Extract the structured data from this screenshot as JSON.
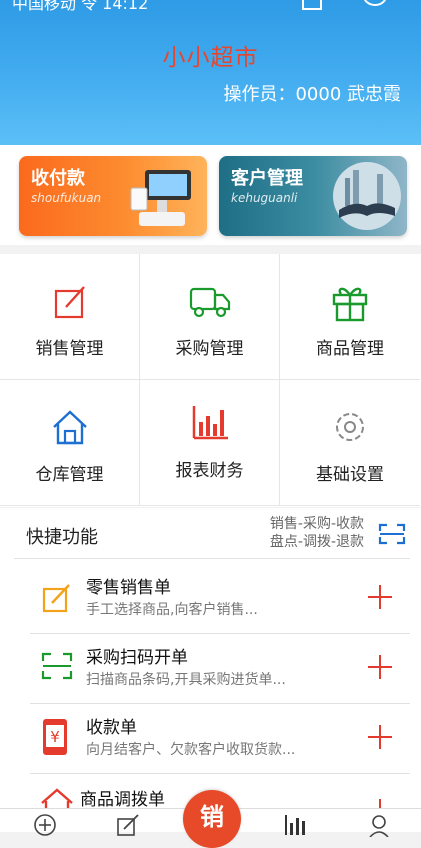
{
  "header": {
    "status_text": "中国移动 令 14:12",
    "store_name": "小小超市",
    "operator": "操作员：0000 武忠霞"
  },
  "banners": [
    {
      "title": "收付款",
      "subtitle": "shoufukuan"
    },
    {
      "title": "客户管理",
      "subtitle": "kehuguanli"
    }
  ],
  "grid": [
    {
      "label": "销售管理",
      "icon": "edit-icon",
      "color": "#e53a2e"
    },
    {
      "label": "采购管理",
      "icon": "truck-icon",
      "color": "#1a9a2c"
    },
    {
      "label": "商品管理",
      "icon": "gift-icon",
      "color": "#1a9a2c"
    },
    {
      "label": "仓库管理",
      "icon": "house-icon",
      "color": "#1d6fd1"
    },
    {
      "label": "报表财务",
      "icon": "bar-chart-icon",
      "color": "#e53a2e"
    },
    {
      "label": "基础设置",
      "icon": "gear-icon",
      "color": "#888888"
    }
  ],
  "quick": {
    "title": "快捷功能",
    "subtitle_line1": "销售-采购-收款",
    "subtitle_line2": "盘点-调拨-退款",
    "items": [
      {
        "title": "零售销售单",
        "desc": "手工选择商品,向客户销售...",
        "icon": "edit-icon"
      },
      {
        "title": "采购扫码开单",
        "desc": "扫描商品条码,开具采购进货单...",
        "icon": "scan-icon"
      },
      {
        "title": "收款单",
        "desc": "向月结客户、欠款客户收取货款...",
        "icon": "phone-yuan-icon"
      },
      {
        "title": "商品调拨单",
        "desc": "",
        "icon": "house-icon"
      }
    ]
  },
  "tabbar": {
    "sell_label": "销"
  }
}
